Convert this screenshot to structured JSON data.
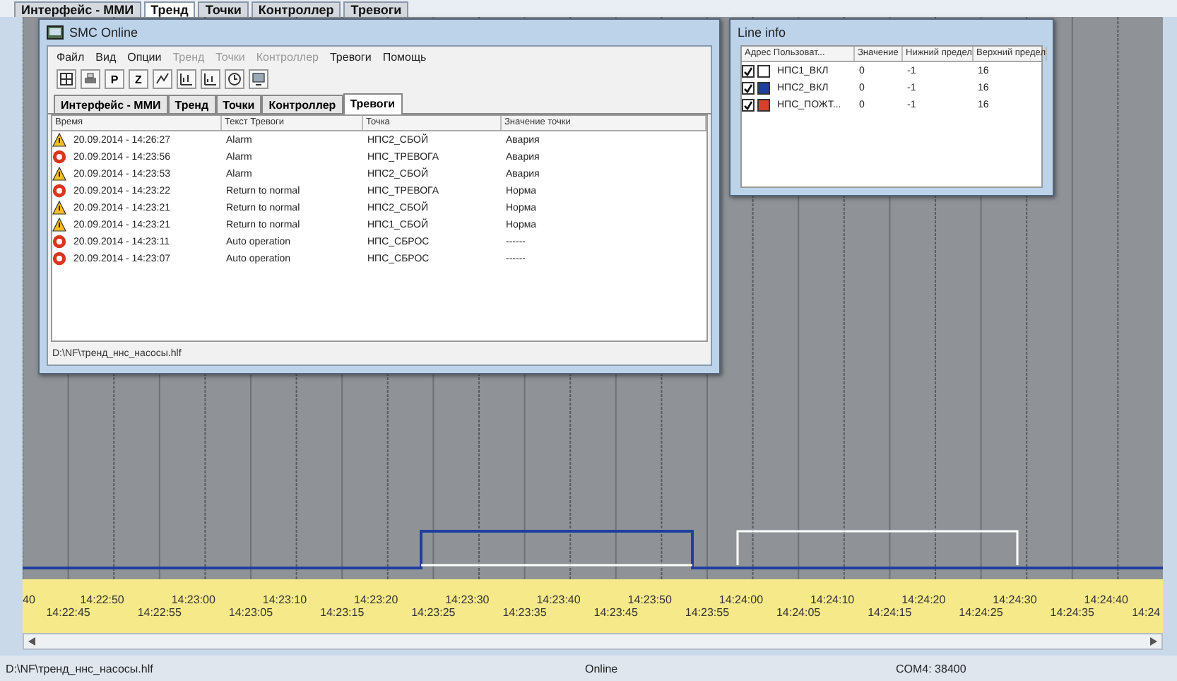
{
  "top_tabs": [
    {
      "label": "Интерфейс - ММИ",
      "selected": false
    },
    {
      "label": "Тренд",
      "selected": true
    },
    {
      "label": "Точки",
      "selected": false
    },
    {
      "label": "Контроллер",
      "selected": false
    },
    {
      "label": "Тревоги",
      "selected": false
    }
  ],
  "alarm_window": {
    "title": "SMC Online",
    "menu": [
      {
        "label": "Файл",
        "disabled": false
      },
      {
        "label": "Вид",
        "disabled": false
      },
      {
        "label": "Опции",
        "disabled": false
      },
      {
        "label": "Тренд",
        "disabled": true
      },
      {
        "label": "Точки",
        "disabled": true
      },
      {
        "label": "Контроллер",
        "disabled": true
      },
      {
        "label": "Тревоги",
        "disabled": false
      },
      {
        "label": "Помощь",
        "disabled": false
      }
    ],
    "toolbar_letters": [
      "P",
      "Z"
    ],
    "tabs": [
      {
        "label": "Интерфейс - ММИ",
        "selected": false
      },
      {
        "label": "Тренд",
        "selected": false
      },
      {
        "label": "Точки",
        "selected": false
      },
      {
        "label": "Контроллер",
        "selected": false
      },
      {
        "label": "Тревоги",
        "selected": true
      }
    ],
    "columns": [
      "Время",
      "Текст Тревоги",
      "Точка",
      "Значение точки"
    ],
    "rows": [
      {
        "kind": "warning",
        "time": "20.09.2014 - 14:26:27",
        "text": "Alarm",
        "point": "НПС2_СБОЙ",
        "value": "Авария"
      },
      {
        "kind": "alarm",
        "time": "20.09.2014 - 14:23:56",
        "text": "Alarm",
        "point": "НПС_ТРЕВОГА",
        "value": "Авария"
      },
      {
        "kind": "warning",
        "time": "20.09.2014 - 14:23:53",
        "text": "Alarm",
        "point": "НПС2_СБОЙ",
        "value": "Авария"
      },
      {
        "kind": "alarm",
        "time": "20.09.2014 - 14:23:22",
        "text": "Return to normal",
        "point": "НПС_ТРЕВОГА",
        "value": "Норма"
      },
      {
        "kind": "warning",
        "time": "20.09.2014 - 14:23:21",
        "text": "Return to normal",
        "point": "НПС2_СБОЙ",
        "value": "Норма"
      },
      {
        "kind": "warning",
        "time": "20.09.2014 - 14:23:21",
        "text": "Return to normal",
        "point": "НПС1_СБОЙ",
        "value": "Норма"
      },
      {
        "kind": "alarm",
        "time": "20.09.2014 - 14:23:11",
        "text": "Auto operation",
        "point": "НПС_СБРОС",
        "value": "------"
      },
      {
        "kind": "alarm",
        "time": "20.09.2014 - 14:23:07",
        "text": "Auto operation",
        "point": "НПС_СБРОС",
        "value": "------"
      }
    ],
    "status": "D:\\NF\\тренд_ннс_насосы.hlf"
  },
  "line_info": {
    "title": "Line info",
    "columns": [
      "Адрес Пользоват...",
      "Значение",
      "Нижний предел",
      "Верхний предел"
    ],
    "rows": [
      {
        "checked": true,
        "color": "#ffffff",
        "name": "НПС1_ВКЛ",
        "value": "0",
        "low": "-1",
        "high": "16"
      },
      {
        "checked": true,
        "color": "#1f3f9f",
        "name": "НПС2_ВКЛ",
        "value": "0",
        "low": "-1",
        "high": "16"
      },
      {
        "checked": true,
        "color": "#d8402a",
        "name": "НПС_ПОЖТ...",
        "value": "0",
        "low": "-1",
        "high": "16"
      }
    ]
  },
  "time_axis": {
    "upper": [
      "40",
      "14:22:50",
      "14:23:00",
      "14:23:10",
      "14:23:20",
      "14:23:30",
      "14:23:40",
      "14:23:50",
      "14:24:00",
      "14:24:10",
      "14:24:20",
      "14:24:30",
      "14:24:40"
    ],
    "lower": [
      "14:22:45",
      "14:22:55",
      "14:23:05",
      "14:23:15",
      "14:23:25",
      "14:23:35",
      "14:23:45",
      "14:23:55",
      "14:24:05",
      "14:24:15",
      "14:24:25",
      "14:24:35",
      "14:24"
    ]
  },
  "status_bar": {
    "file": "D:\\NF\\тренд_ннс_насосы.hlf",
    "connection": "Online",
    "port": "COM4: 38400"
  }
}
